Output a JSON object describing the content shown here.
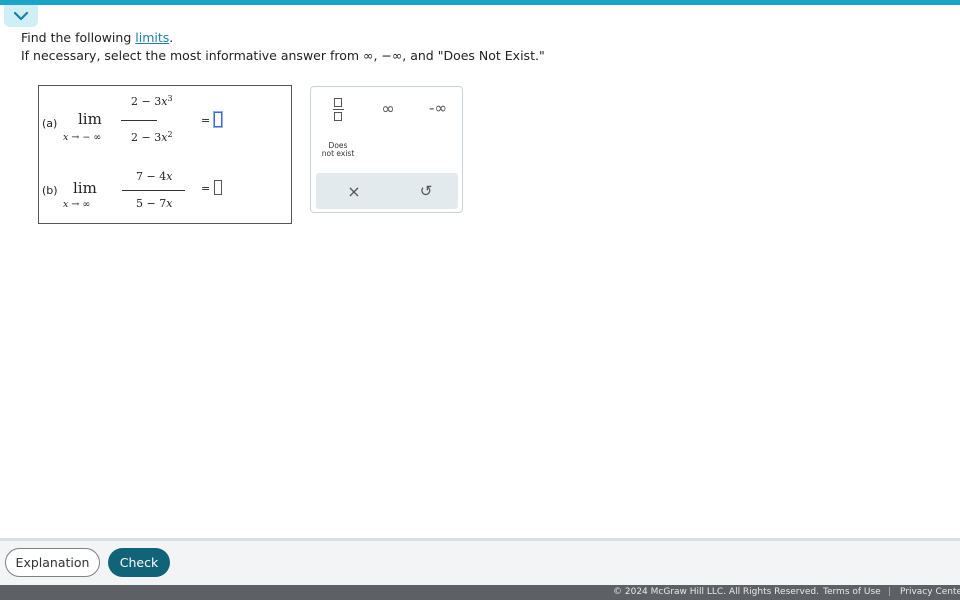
{
  "instructions": {
    "prefix": "Find the following ",
    "link": "limits",
    "suffix": ".",
    "line2": "If necessary, select the most informative answer from ∞, −∞, and \"Does Not Exist.\""
  },
  "problems": [
    {
      "label": "(a)",
      "lim": "lim",
      "var": "x",
      "arrow": "→",
      "approach": "− ∞",
      "numerator": {
        "coef": "2 − 3",
        "var": "x",
        "exp": "3"
      },
      "denominator": {
        "coef": "2 − 3",
        "var": "x",
        "exp": "2"
      },
      "equals": "="
    },
    {
      "label": "(b)",
      "lim": "lim",
      "var": "x",
      "arrow": "→",
      "approach": "∞",
      "numerator": {
        "coef": "7 − 4",
        "var": "x"
      },
      "denominator": {
        "coef": "5 − 7",
        "var": "x"
      },
      "equals": "="
    }
  ],
  "palette": {
    "infinity": "∞",
    "neg_infinity": "-∞",
    "dne_line1": "Does",
    "dne_line2": "not exist",
    "clear": "×",
    "undo": "↺"
  },
  "footer": {
    "explanation": "Explanation",
    "check": "Check",
    "copyright": "© 2024 McGraw Hill LLC. All Rights Reserved.",
    "terms": "Terms of Use",
    "separator": "|",
    "privacy": "Privacy Cente"
  },
  "colors": {
    "accent": "#1aa4c8",
    "check_button": "#116477",
    "link": "#1f7fa6"
  }
}
